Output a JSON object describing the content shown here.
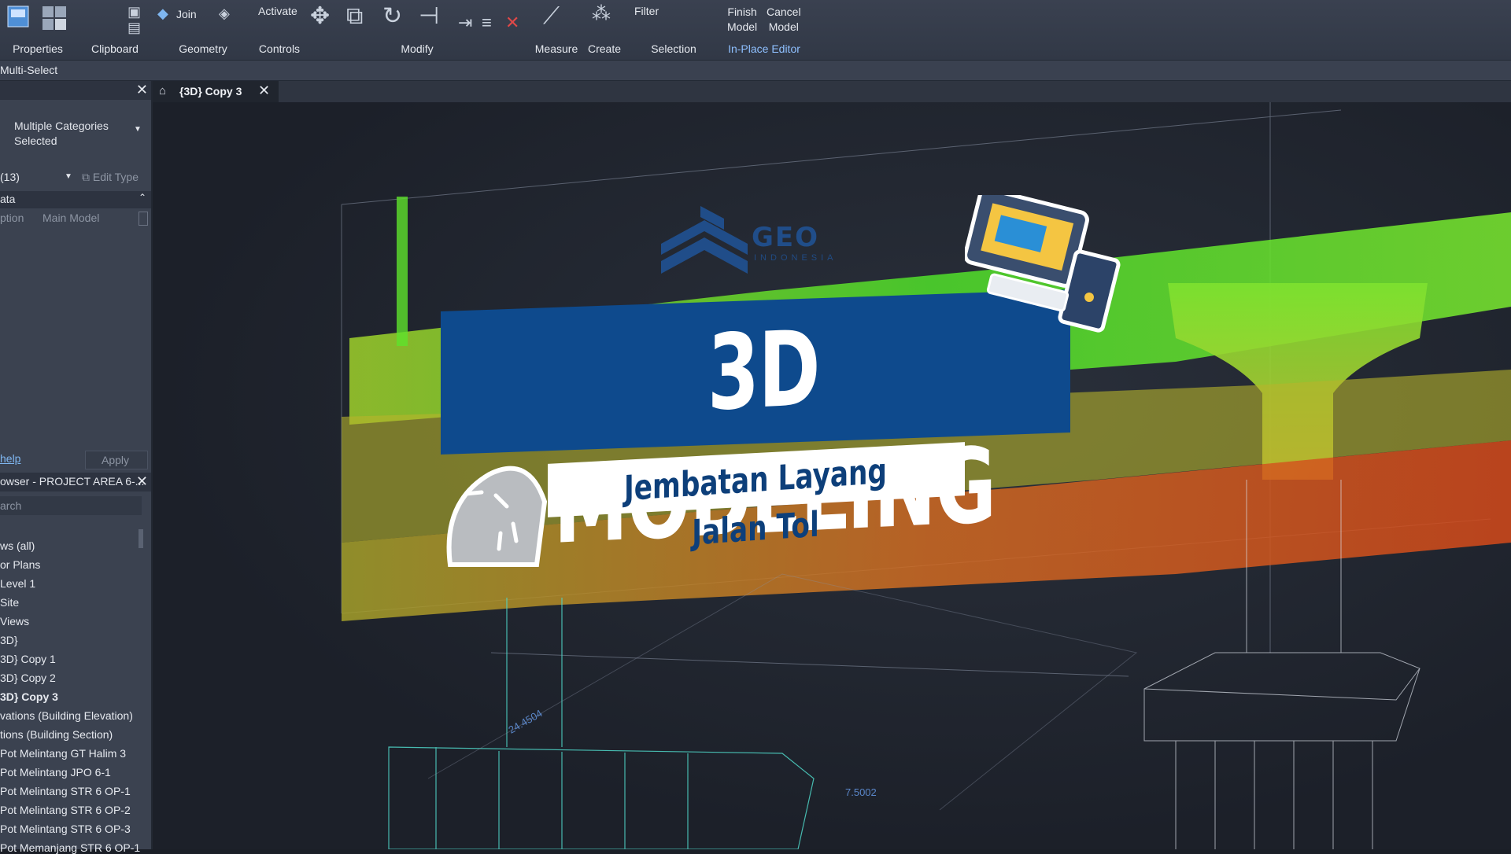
{
  "ribbon": {
    "groups": [
      {
        "label": "Properties"
      },
      {
        "label": "Clipboard"
      },
      {
        "label": "Geometry"
      },
      {
        "label": "Controls"
      },
      {
        "label": "Modify"
      },
      {
        "label": "Measure"
      },
      {
        "label": "Create"
      },
      {
        "label": "Selection"
      },
      {
        "label": "In-Place Editor"
      }
    ],
    "join_label": "Join",
    "activate_label": "Activate",
    "filter_label": "Filter",
    "finish_model_label": "Finish\nModel",
    "cancel_model_label": "Cancel\nModel"
  },
  "multiselect": "Multi-Select",
  "properties_panel": {
    "type_selector": "Multiple Categories\nSelected",
    "count": "(13)",
    "edit_type": "Edit Type",
    "section": "ata",
    "row_label": "ption",
    "row_value": "Main Model",
    "help_link": "help",
    "apply_label": "Apply"
  },
  "browser": {
    "title": "owser - PROJECT AREA 6-...",
    "search_placeholder": "arch",
    "items": [
      "ws (all)",
      "or Plans",
      "Level 1",
      "Site",
      "Views",
      "3D}",
      "3D} Copy 1",
      "3D} Copy 2",
      "3D} Copy 3",
      "vations (Building Elevation)",
      "tions (Building Section)",
      "Pot Melintang GT Halim 3",
      "Pot Melintang JPO 6-1",
      "Pot Melintang STR 6 OP-1",
      "Pot Melintang STR 6 OP-2",
      "Pot Melintang STR 6 OP-3",
      "Pot Memanjang STR 6 OP-1"
    ],
    "active_index": 8
  },
  "view_tab": {
    "label": "{3D} Copy 3"
  },
  "overlay": {
    "title": "3D MODELING",
    "subtitle": "Jembatan Layang Jalan Tol",
    "logo": "GEO",
    "logo_sub": "INDONESIA"
  },
  "dimensions": {
    "d1": "24.4504",
    "d2": "7.5002"
  },
  "colors": {
    "accent_blue": "#0e4a8d",
    "point_green": "#5ee22c",
    "point_orange": "#d8591c"
  }
}
